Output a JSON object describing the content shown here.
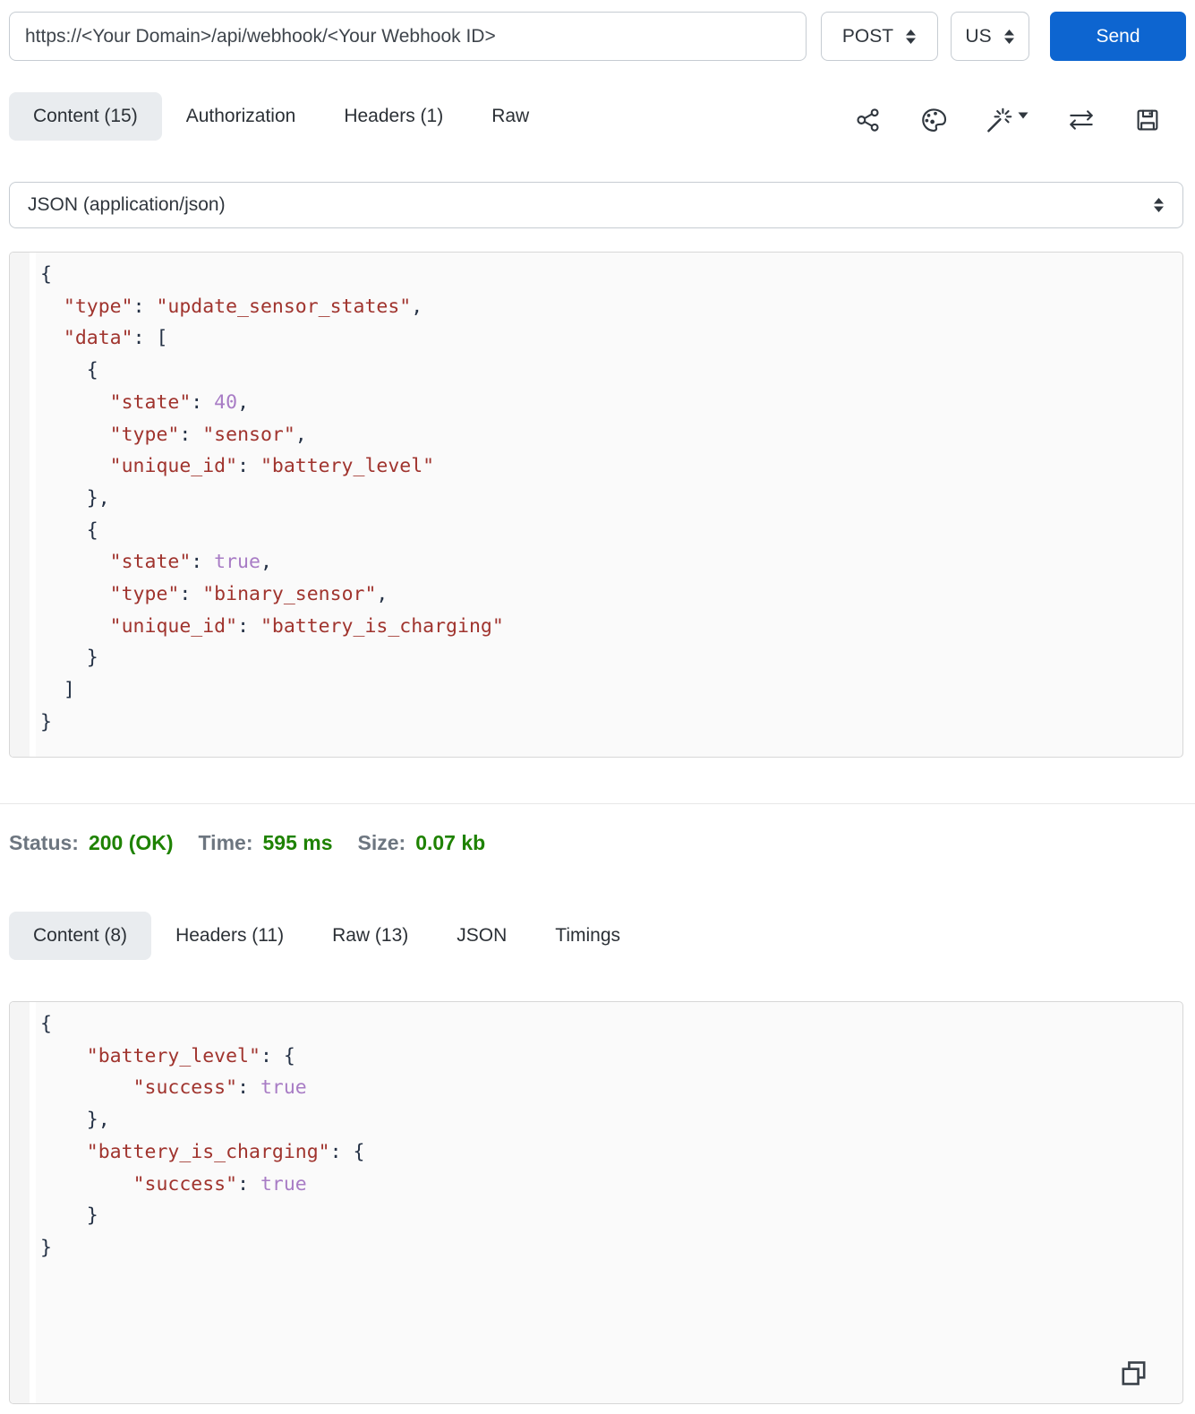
{
  "request_bar": {
    "url": "https://<Your Domain>/api/webhook/<Your Webhook ID>",
    "method": "POST",
    "region": "US",
    "send_label": "Send"
  },
  "request_tabs": [
    {
      "label": "Content (15)",
      "active": true
    },
    {
      "label": "Authorization",
      "active": false
    },
    {
      "label": "Headers (1)",
      "active": false
    },
    {
      "label": "Raw",
      "active": false
    }
  ],
  "toolbar_icons": [
    "share-icon",
    "palette-icon",
    "magic-wand-dropdown-icon",
    "swap-icon",
    "save-icon"
  ],
  "body_type_select": {
    "value": "JSON (application/json)"
  },
  "request_body": {
    "lines": [
      [
        [
          "{"
        ]
      ],
      [
        [
          "  "
        ],
        [
          "\"type\"",
          "s"
        ],
        [
          ": "
        ],
        [
          "\"update_sensor_states\"",
          "s"
        ],
        [
          ","
        ]
      ],
      [
        [
          "  "
        ],
        [
          "\"data\"",
          "s"
        ],
        [
          ": ["
        ]
      ],
      [
        [
          "    {"
        ]
      ],
      [
        [
          "      "
        ],
        [
          "\"state\"",
          "s"
        ],
        [
          ": "
        ],
        [
          "40",
          "n"
        ],
        [
          ","
        ]
      ],
      [
        [
          "      "
        ],
        [
          "\"type\"",
          "s"
        ],
        [
          ": "
        ],
        [
          "\"sensor\"",
          "s"
        ],
        [
          ","
        ]
      ],
      [
        [
          "      "
        ],
        [
          "\"unique_id\"",
          "s"
        ],
        [
          ": "
        ],
        [
          "\"battery_level\"",
          "s"
        ]
      ],
      [
        [
          "    },"
        ]
      ],
      [
        [
          "    {"
        ]
      ],
      [
        [
          "      "
        ],
        [
          "\"state\"",
          "s"
        ],
        [
          ": "
        ],
        [
          "true",
          "n"
        ],
        [
          ","
        ]
      ],
      [
        [
          "      "
        ],
        [
          "\"type\"",
          "s"
        ],
        [
          ": "
        ],
        [
          "\"binary_sensor\"",
          "s"
        ],
        [
          ","
        ]
      ],
      [
        [
          "      "
        ],
        [
          "\"unique_id\"",
          "s"
        ],
        [
          ": "
        ],
        [
          "\"battery_is_charging\"",
          "s"
        ]
      ],
      [
        [
          "    }"
        ]
      ],
      [
        [
          "  ]"
        ]
      ],
      [
        [
          "}"
        ]
      ]
    ]
  },
  "response": {
    "status_label": "Status:",
    "status_value": "200 (OK)",
    "time_label": "Time:",
    "time_value": "595 ms",
    "size_label": "Size:",
    "size_value": "0.07 kb",
    "tabs": [
      {
        "label": "Content (8)",
        "active": true
      },
      {
        "label": "Headers (11)",
        "active": false
      },
      {
        "label": "Raw (13)",
        "active": false
      },
      {
        "label": "JSON",
        "active": false
      },
      {
        "label": "Timings",
        "active": false
      }
    ],
    "body_lines": [
      [
        [
          "{"
        ]
      ],
      [
        [
          "    "
        ],
        [
          "\"battery_level\"",
          "s"
        ],
        [
          ": {"
        ]
      ],
      [
        [
          "        "
        ],
        [
          "\"success\"",
          "s"
        ],
        [
          ": "
        ],
        [
          "true",
          "n"
        ]
      ],
      [
        [
          "    },"
        ]
      ],
      [
        [
          "    "
        ],
        [
          "\"battery_is_charging\"",
          "s"
        ],
        [
          ": {"
        ]
      ],
      [
        [
          "        "
        ],
        [
          "\"success\"",
          "s"
        ],
        [
          ": "
        ],
        [
          "true",
          "n"
        ]
      ],
      [
        [
          "    }"
        ]
      ],
      [
        [
          "}"
        ]
      ]
    ]
  },
  "colors": {
    "accent_blue": "#0d65d0",
    "active_tab_bg": "#e9ecef",
    "status_green": "#1e8200",
    "code_string": "#a0342e",
    "code_literal": "#a87cc5",
    "code_punctuation": "#253246",
    "code_background": "#fafafa"
  }
}
